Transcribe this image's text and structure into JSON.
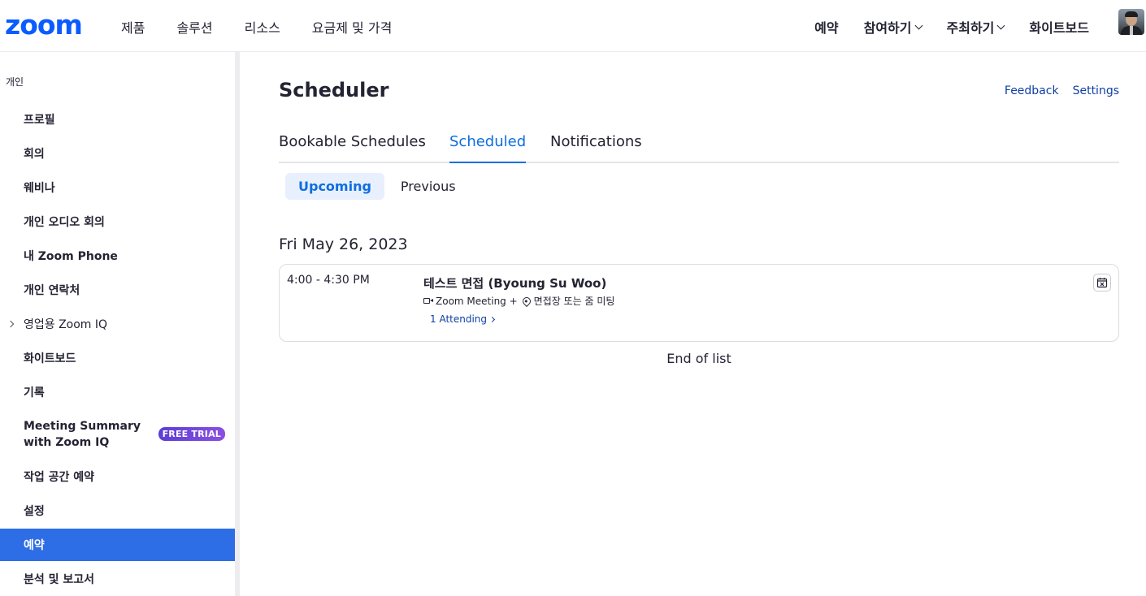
{
  "topnav": {
    "logo": "zoom",
    "left_items": [
      "제품",
      "솔루션",
      "리소스",
      "요금제 및 가격"
    ],
    "right_items": [
      {
        "label": "예약",
        "has_dropdown": false
      },
      {
        "label": "참여하기",
        "has_dropdown": true
      },
      {
        "label": "주최하기",
        "has_dropdown": true
      },
      {
        "label": "화이트보드",
        "has_dropdown": false
      }
    ]
  },
  "sidebar": {
    "section_label": "개인",
    "items": [
      {
        "label": "프로필"
      },
      {
        "label": "회의"
      },
      {
        "label": "웨비나"
      },
      {
        "label": "개인 오디오 회의"
      },
      {
        "label": "내 Zoom Phone"
      },
      {
        "label": "개인 연락처"
      },
      {
        "label": "영업용 Zoom IQ",
        "expandable": true
      },
      {
        "label": "화이트보드"
      },
      {
        "label": "기록"
      },
      {
        "label": "Meeting Summary with Zoom IQ",
        "badge": "FREE TRIAL"
      },
      {
        "label": "작업 공간 예약"
      },
      {
        "label": "설정"
      },
      {
        "label": "예약",
        "active": true
      },
      {
        "label": "분석 및 보고서"
      }
    ]
  },
  "main": {
    "title": "Scheduler",
    "feedback_label": "Feedback",
    "settings_label": "Settings",
    "tabs": [
      {
        "label": "Bookable Schedules",
        "active": false
      },
      {
        "label": "Scheduled",
        "active": true
      },
      {
        "label": "Notifications",
        "active": false
      }
    ],
    "subtabs": [
      {
        "label": "Upcoming",
        "active": true
      },
      {
        "label": "Previous",
        "active": false
      }
    ],
    "date_heading": "Fri May 26, 2023",
    "event": {
      "time": "4:00 - 4:30 PM",
      "title": "테스트 면접 (Byoung Su Woo)",
      "meeting_type": "Zoom Meeting +",
      "location": "면접장 또는 줌 미팅",
      "attending": "1 Attending"
    },
    "end_of_list": "End of list"
  },
  "colors": {
    "brand": "#0b5cff",
    "active_sidebar": "#2d6ee6",
    "active_tab": "#0e6ee0",
    "link": "#0e3fa3",
    "badge": "#7346dc"
  }
}
